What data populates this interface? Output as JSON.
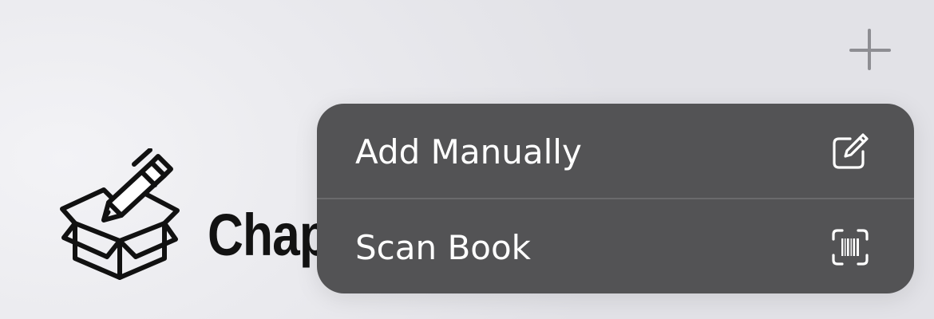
{
  "header": {
    "add_button_icon": "plus-icon"
  },
  "app": {
    "title": "Chap",
    "logo_icon": "open-box-with-pen-icon"
  },
  "menu": {
    "items": [
      {
        "label": "Add Manually",
        "icon": "square-and-pencil-icon"
      },
      {
        "label": "Scan Book",
        "icon": "barcode-viewfinder-icon"
      }
    ]
  },
  "colors": {
    "background": "#e7e7eb",
    "menu_background": "#535355",
    "menu_text": "#ffffff",
    "title_text": "#121212",
    "plus_icon": "#8e8e93"
  }
}
